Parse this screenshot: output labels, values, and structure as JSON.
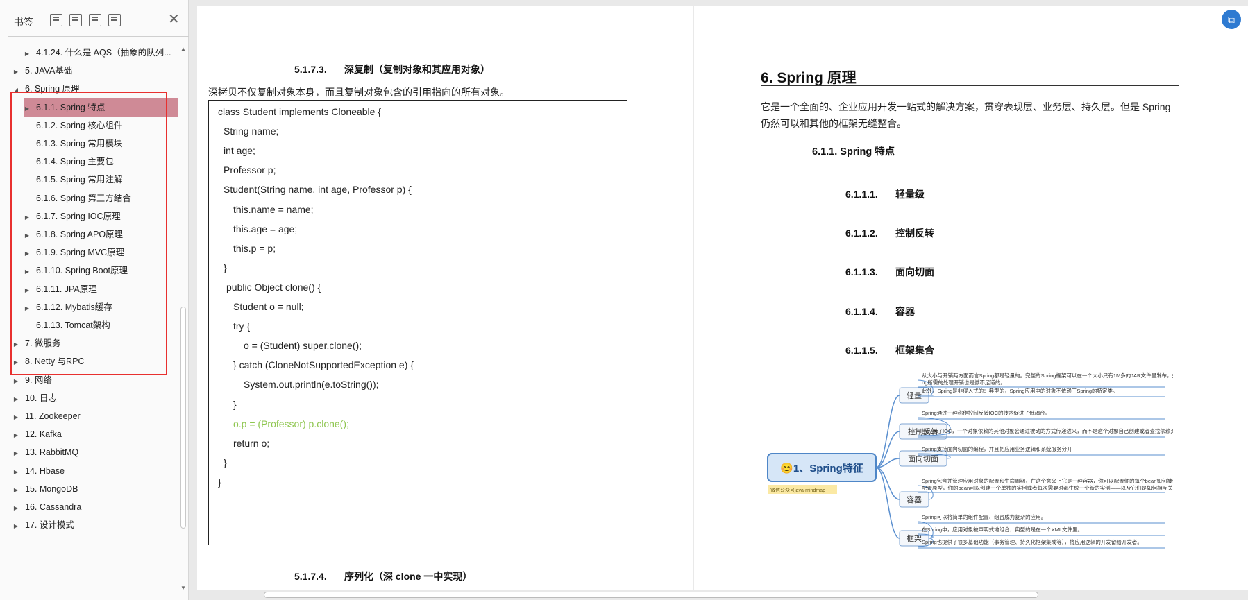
{
  "sidebar": {
    "title": "书签",
    "toolbar": [
      "bookmark-expand-icon",
      "bookmark-collapse-icon",
      "bookmark-add-icon",
      "bookmark-options-icon"
    ],
    "items": [
      {
        "label": "4.1.24. 什么是 AQS（抽象的队列...",
        "level": 1,
        "caret": "right",
        "selected": false
      },
      {
        "label": "5. JAVA基础",
        "level": 0,
        "caret": "right",
        "selected": false
      },
      {
        "label": "6. Spring 原理",
        "level": 0,
        "caret": "down",
        "selected": false
      },
      {
        "label": "6.1.1. Spring 特点",
        "level": 1,
        "caret": "right",
        "selected": true
      },
      {
        "label": "6.1.2. Spring 核心组件",
        "level": 1,
        "caret": "",
        "selected": false
      },
      {
        "label": "6.1.3. Spring 常用模块",
        "level": 1,
        "caret": "",
        "selected": false
      },
      {
        "label": "6.1.4. Spring 主要包",
        "level": 1,
        "caret": "",
        "selected": false
      },
      {
        "label": "6.1.5. Spring 常用注解",
        "level": 1,
        "caret": "",
        "selected": false
      },
      {
        "label": "6.1.6. Spring 第三方结合",
        "level": 1,
        "caret": "",
        "selected": false
      },
      {
        "label": "6.1.7. Spring IOC原理",
        "level": 1,
        "caret": "right",
        "selected": false
      },
      {
        "label": "6.1.8. Spring APO原理",
        "level": 1,
        "caret": "right",
        "selected": false
      },
      {
        "label": "6.1.9. Spring MVC原理",
        "level": 1,
        "caret": "right",
        "selected": false
      },
      {
        "label": "6.1.10. Spring Boot原理",
        "level": 1,
        "caret": "right",
        "selected": false
      },
      {
        "label": "6.1.11. JPA原理",
        "level": 1,
        "caret": "right",
        "selected": false
      },
      {
        "label": "6.1.12. Mybatis缓存",
        "level": 1,
        "caret": "right",
        "selected": false
      },
      {
        "label": "6.1.13. Tomcat架构",
        "level": 1,
        "caret": "",
        "selected": false
      },
      {
        "label": "7.   微服务",
        "level": 0,
        "caret": "right",
        "selected": false
      },
      {
        "label": "8. Netty 与RPC",
        "level": 0,
        "caret": "right",
        "selected": false
      },
      {
        "label": "9. 网络",
        "level": 0,
        "caret": "right",
        "selected": false
      },
      {
        "label": "10. 日志",
        "level": 0,
        "caret": "right",
        "selected": false
      },
      {
        "label": "11. Zookeeper",
        "level": 0,
        "caret": "right",
        "selected": false
      },
      {
        "label": "12. Kafka",
        "level": 0,
        "caret": "right",
        "selected": false
      },
      {
        "label": "13. RabbitMQ",
        "level": 0,
        "caret": "right",
        "selected": false
      },
      {
        "label": "14. Hbase",
        "level": 0,
        "caret": "right",
        "selected": false
      },
      {
        "label": "15. MongoDB",
        "level": 0,
        "caret": "right",
        "selected": false
      },
      {
        "label": "16. Cassandra",
        "level": 0,
        "caret": "right",
        "selected": false
      },
      {
        "label": "17. 设计模式",
        "level": 0,
        "caret": "right",
        "selected": false
      }
    ]
  },
  "left_page": {
    "h_deep": {
      "num": "5.1.7.3.",
      "text": "深复制（复制对象和其应用对象）"
    },
    "deep_para": "深拷贝不仅复制对象本身，而且复制对象包含的引用指向的所有对象。",
    "code": [
      {
        "t": "class Student implements Cloneable {",
        "indent": 0
      },
      {
        "t": "String name;",
        "indent": 1
      },
      {
        "t": "int age;",
        "indent": 1
      },
      {
        "t": "Professor p;",
        "indent": 1
      },
      {
        "t": "Student(String name, int age, Professor p) {",
        "indent": 1
      },
      {
        "t": "this.name = name;",
        "indent": 2
      },
      {
        "t": "this.age = age;",
        "indent": 2
      },
      {
        "t": "this.p = p;",
        "indent": 2
      },
      {
        "t": "}",
        "indent": 1
      },
      {
        "t": "public Object clone() {",
        "indent": 1.3
      },
      {
        "t": "Student o = null;",
        "indent": 2
      },
      {
        "t": "try {",
        "indent": 2
      },
      {
        "t": "o = (Student) super.clone();",
        "indent": 3
      },
      {
        "t": "} catch (CloneNotSupportedException e) {",
        "indent": 2
      },
      {
        "t": "System.out.println(e.toString());",
        "indent": 3
      },
      {
        "t": "}",
        "indent": 2
      },
      {
        "t": "o.p = (Professor) p.clone();",
        "indent": 2,
        "green": true
      },
      {
        "t": "return o;",
        "indent": 2
      },
      {
        "t": "}",
        "indent": 1
      },
      {
        "t": "}",
        "indent": 0
      }
    ],
    "h_serial": {
      "num": "5.1.7.4.",
      "text": "序列化（深 clone 一中实现）"
    }
  },
  "right_page": {
    "title": "6. Spring 原理",
    "intro": "它是一个全面的、企业应用开发一站式的解决方案，贯穿表现层、业务层、持久层。但是 Spring 仍然可以和其他的框架无缝整合。",
    "h611": "6.1.1.  Spring 特点",
    "subs": [
      {
        "num": "6.1.1.1.",
        "text": "轻量级"
      },
      {
        "num": "6.1.1.2.",
        "text": "控制反转"
      },
      {
        "num": "6.1.1.3.",
        "text": "面向切面"
      },
      {
        "num": "6.1.1.4.",
        "text": "容器"
      },
      {
        "num": "6.1.1.5.",
        "text": "框架集合"
      }
    ],
    "mindmap": {
      "root": "😊1、Spring特征",
      "tag": "微信公众号java-mindmap",
      "branches": [
        {
          "name": "轻量",
          "notes": [
            "从大小与开销两方面而言Spring都是轻量的。完整的Spring框架可以在一个大小只有1M多的JAR文件里发布，并且Spring所需的处理开销也是微不足道的。",
            "此外，Spring是非侵入式的：典型的，Spring应用中的对象不依赖于Spring的特定类。"
          ]
        },
        {
          "name": "控制反转",
          "notes": [
            "Spring通过一种称作控制反转IOC的技术促进了低耦合。",
            "当应用了IOC，一个对象依赖的其他对象会通过被动的方式传递进来，而不是这个对象自己创建或者查找依赖对象。"
          ]
        },
        {
          "name": "面向切面",
          "notes": [
            "Spring支持面向切面的编程，并且把应用业务逻辑和系统服务分开"
          ]
        },
        {
          "name": "容器",
          "notes": [
            "Spring包含并管理应用对象的配置和生命周期，在这个意义上它是一种容器，你可以配置你的每个bean如何被创建——基于一个可配置原型，你的bean可以创建一个单独的实例或者每次需要时都生成一个新的实例——以及它们是如何相互关联的。"
          ]
        },
        {
          "name": "框架",
          "notes": [
            "Spring可以将简单的组件配置、组合成为复杂的应用。",
            "在Spring中，应用对象被声明式地组合，典型的是在一个XML文件里。",
            "Spring也提供了很多基础功能（事务管理、持久化框架集成等），将应用逻辑的开发留给开发者。"
          ]
        }
      ]
    }
  },
  "colors": {
    "selected": "#cf8a96",
    "highlight_box": "#e8302f",
    "code_green": "#8fc650",
    "mind_root_fill": "#d6e6f7",
    "mind_root_border": "#4e86c7",
    "badge": "#2e7ad1"
  }
}
